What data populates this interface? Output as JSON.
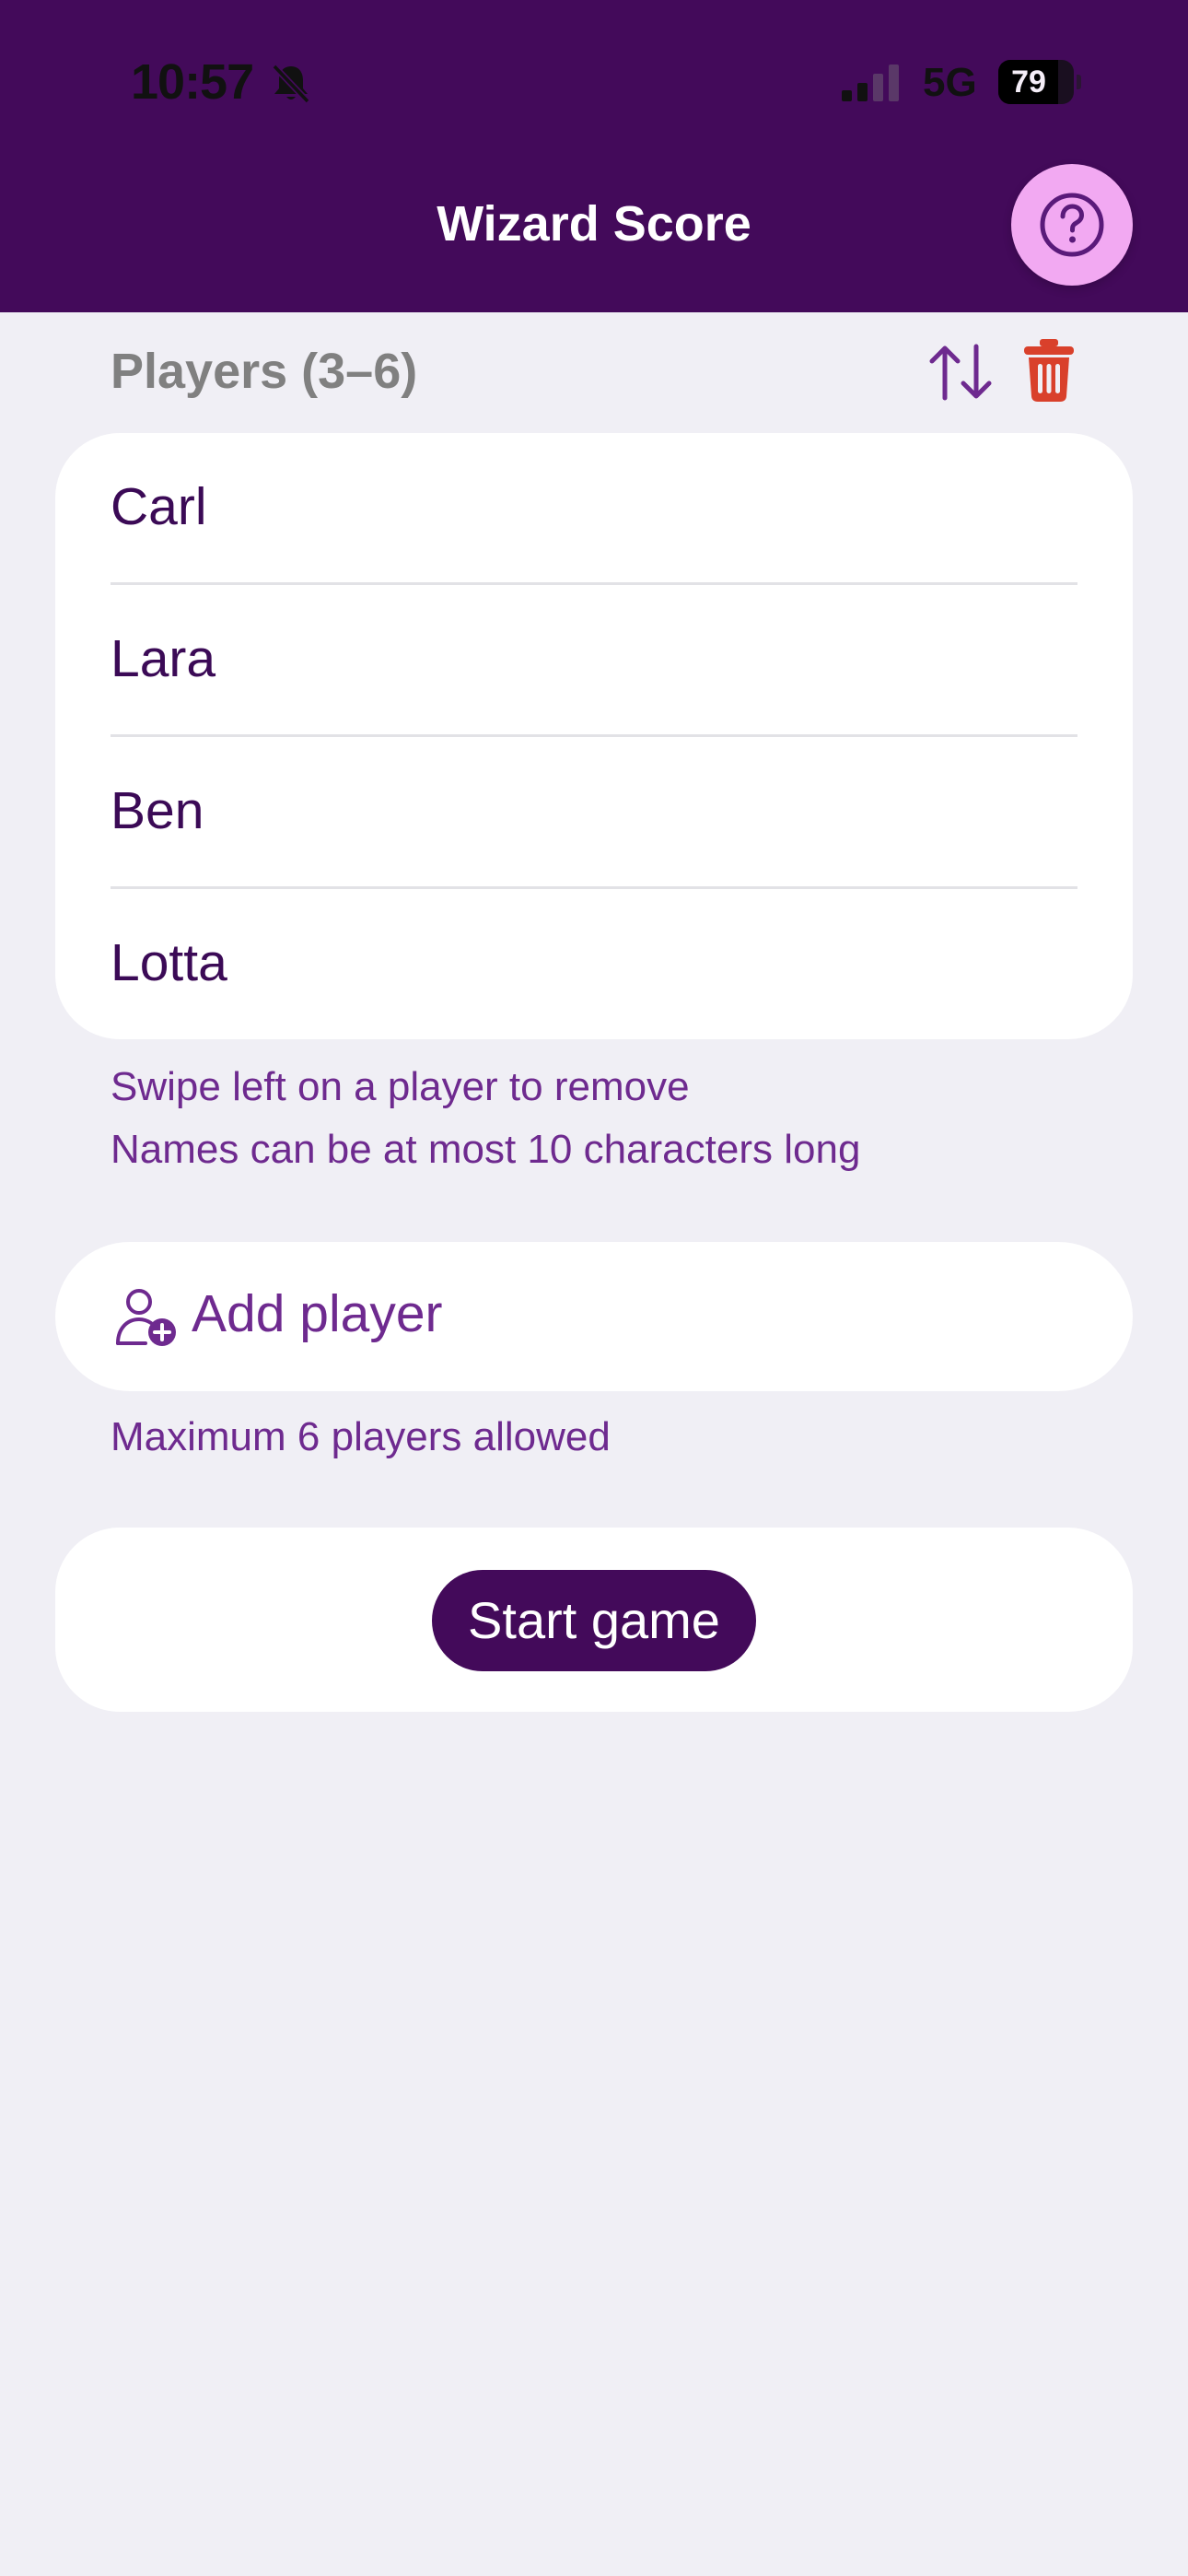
{
  "status_bar": {
    "time": "10:57",
    "network": "5G",
    "battery_level": "79",
    "battery_fraction": 0.79,
    "bell_icon": "bell-slash-icon",
    "signal_icon": "cellular-signal-icon"
  },
  "header": {
    "title": "Wizard Score",
    "help_icon": "question-mark-circle-icon"
  },
  "players_section": {
    "title": "Players (3–6)",
    "sort_icon": "sort-arrows-icon",
    "delete_icon": "trash-icon",
    "players": [
      {
        "name": "Carl"
      },
      {
        "name": "Lara"
      },
      {
        "name": "Ben"
      },
      {
        "name": "Lotta"
      }
    ],
    "hint_swipe": "Swipe left on a player to remove",
    "hint_length": "Names can be at most 10 characters long"
  },
  "add_player": {
    "label": "Add player",
    "icon": "add-person-icon",
    "limit_note": "Maximum 6 players allowed"
  },
  "start": {
    "label": "Start game"
  },
  "colors": {
    "header_background": "#430A5A",
    "page_background": "#F0EFF5",
    "accent_purple": "#6E2A8F",
    "help_button": "#F2A9F2",
    "delete_red": "#D9402B"
  }
}
